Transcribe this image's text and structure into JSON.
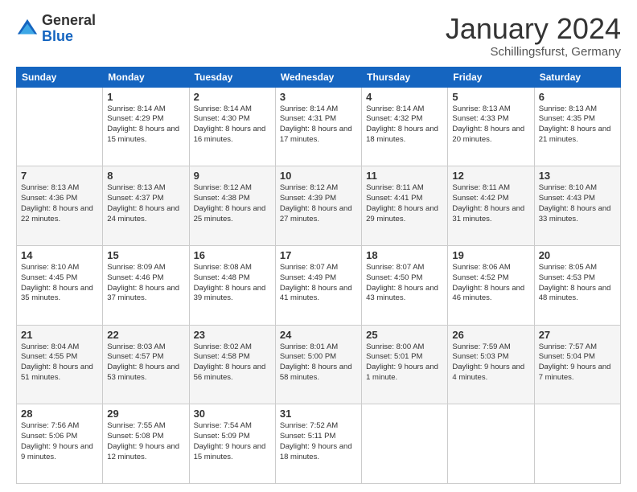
{
  "logo": {
    "general": "General",
    "blue": "Blue"
  },
  "header": {
    "month": "January 2024",
    "location": "Schillingsfurst, Germany"
  },
  "days": [
    "Sunday",
    "Monday",
    "Tuesday",
    "Wednesday",
    "Thursday",
    "Friday",
    "Saturday"
  ],
  "weeks": [
    [
      {
        "day": "",
        "sunrise": "",
        "sunset": "",
        "daylight": ""
      },
      {
        "day": "1",
        "sunrise": "Sunrise: 8:14 AM",
        "sunset": "Sunset: 4:29 PM",
        "daylight": "Daylight: 8 hours and 15 minutes."
      },
      {
        "day": "2",
        "sunrise": "Sunrise: 8:14 AM",
        "sunset": "Sunset: 4:30 PM",
        "daylight": "Daylight: 8 hours and 16 minutes."
      },
      {
        "day": "3",
        "sunrise": "Sunrise: 8:14 AM",
        "sunset": "Sunset: 4:31 PM",
        "daylight": "Daylight: 8 hours and 17 minutes."
      },
      {
        "day": "4",
        "sunrise": "Sunrise: 8:14 AM",
        "sunset": "Sunset: 4:32 PM",
        "daylight": "Daylight: 8 hours and 18 minutes."
      },
      {
        "day": "5",
        "sunrise": "Sunrise: 8:13 AM",
        "sunset": "Sunset: 4:33 PM",
        "daylight": "Daylight: 8 hours and 20 minutes."
      },
      {
        "day": "6",
        "sunrise": "Sunrise: 8:13 AM",
        "sunset": "Sunset: 4:35 PM",
        "daylight": "Daylight: 8 hours and 21 minutes."
      }
    ],
    [
      {
        "day": "7",
        "sunrise": "Sunrise: 8:13 AM",
        "sunset": "Sunset: 4:36 PM",
        "daylight": "Daylight: 8 hours and 22 minutes."
      },
      {
        "day": "8",
        "sunrise": "Sunrise: 8:13 AM",
        "sunset": "Sunset: 4:37 PM",
        "daylight": "Daylight: 8 hours and 24 minutes."
      },
      {
        "day": "9",
        "sunrise": "Sunrise: 8:12 AM",
        "sunset": "Sunset: 4:38 PM",
        "daylight": "Daylight: 8 hours and 25 minutes."
      },
      {
        "day": "10",
        "sunrise": "Sunrise: 8:12 AM",
        "sunset": "Sunset: 4:39 PM",
        "daylight": "Daylight: 8 hours and 27 minutes."
      },
      {
        "day": "11",
        "sunrise": "Sunrise: 8:11 AM",
        "sunset": "Sunset: 4:41 PM",
        "daylight": "Daylight: 8 hours and 29 minutes."
      },
      {
        "day": "12",
        "sunrise": "Sunrise: 8:11 AM",
        "sunset": "Sunset: 4:42 PM",
        "daylight": "Daylight: 8 hours and 31 minutes."
      },
      {
        "day": "13",
        "sunrise": "Sunrise: 8:10 AM",
        "sunset": "Sunset: 4:43 PM",
        "daylight": "Daylight: 8 hours and 33 minutes."
      }
    ],
    [
      {
        "day": "14",
        "sunrise": "Sunrise: 8:10 AM",
        "sunset": "Sunset: 4:45 PM",
        "daylight": "Daylight: 8 hours and 35 minutes."
      },
      {
        "day": "15",
        "sunrise": "Sunrise: 8:09 AM",
        "sunset": "Sunset: 4:46 PM",
        "daylight": "Daylight: 8 hours and 37 minutes."
      },
      {
        "day": "16",
        "sunrise": "Sunrise: 8:08 AM",
        "sunset": "Sunset: 4:48 PM",
        "daylight": "Daylight: 8 hours and 39 minutes."
      },
      {
        "day": "17",
        "sunrise": "Sunrise: 8:07 AM",
        "sunset": "Sunset: 4:49 PM",
        "daylight": "Daylight: 8 hours and 41 minutes."
      },
      {
        "day": "18",
        "sunrise": "Sunrise: 8:07 AM",
        "sunset": "Sunset: 4:50 PM",
        "daylight": "Daylight: 8 hours and 43 minutes."
      },
      {
        "day": "19",
        "sunrise": "Sunrise: 8:06 AM",
        "sunset": "Sunset: 4:52 PM",
        "daylight": "Daylight: 8 hours and 46 minutes."
      },
      {
        "day": "20",
        "sunrise": "Sunrise: 8:05 AM",
        "sunset": "Sunset: 4:53 PM",
        "daylight": "Daylight: 8 hours and 48 minutes."
      }
    ],
    [
      {
        "day": "21",
        "sunrise": "Sunrise: 8:04 AM",
        "sunset": "Sunset: 4:55 PM",
        "daylight": "Daylight: 8 hours and 51 minutes."
      },
      {
        "day": "22",
        "sunrise": "Sunrise: 8:03 AM",
        "sunset": "Sunset: 4:57 PM",
        "daylight": "Daylight: 8 hours and 53 minutes."
      },
      {
        "day": "23",
        "sunrise": "Sunrise: 8:02 AM",
        "sunset": "Sunset: 4:58 PM",
        "daylight": "Daylight: 8 hours and 56 minutes."
      },
      {
        "day": "24",
        "sunrise": "Sunrise: 8:01 AM",
        "sunset": "Sunset: 5:00 PM",
        "daylight": "Daylight: 8 hours and 58 minutes."
      },
      {
        "day": "25",
        "sunrise": "Sunrise: 8:00 AM",
        "sunset": "Sunset: 5:01 PM",
        "daylight": "Daylight: 9 hours and 1 minute."
      },
      {
        "day": "26",
        "sunrise": "Sunrise: 7:59 AM",
        "sunset": "Sunset: 5:03 PM",
        "daylight": "Daylight: 9 hours and 4 minutes."
      },
      {
        "day": "27",
        "sunrise": "Sunrise: 7:57 AM",
        "sunset": "Sunset: 5:04 PM",
        "daylight": "Daylight: 9 hours and 7 minutes."
      }
    ],
    [
      {
        "day": "28",
        "sunrise": "Sunrise: 7:56 AM",
        "sunset": "Sunset: 5:06 PM",
        "daylight": "Daylight: 9 hours and 9 minutes."
      },
      {
        "day": "29",
        "sunrise": "Sunrise: 7:55 AM",
        "sunset": "Sunset: 5:08 PM",
        "daylight": "Daylight: 9 hours and 12 minutes."
      },
      {
        "day": "30",
        "sunrise": "Sunrise: 7:54 AM",
        "sunset": "Sunset: 5:09 PM",
        "daylight": "Daylight: 9 hours and 15 minutes."
      },
      {
        "day": "31",
        "sunrise": "Sunrise: 7:52 AM",
        "sunset": "Sunset: 5:11 PM",
        "daylight": "Daylight: 9 hours and 18 minutes."
      },
      {
        "day": "",
        "sunrise": "",
        "sunset": "",
        "daylight": ""
      },
      {
        "day": "",
        "sunrise": "",
        "sunset": "",
        "daylight": ""
      },
      {
        "day": "",
        "sunrise": "",
        "sunset": "",
        "daylight": ""
      }
    ]
  ]
}
